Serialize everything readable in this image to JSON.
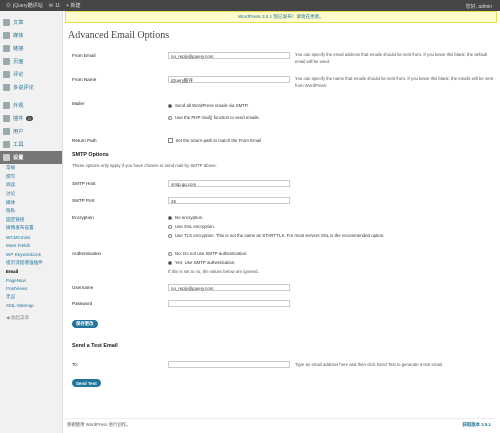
{
  "topbar": {
    "site": "jQuery酷评站",
    "comments": "11",
    "new": "+ 新建",
    "user": "您好, admin"
  },
  "notice": "WordPress 3.5.1 现已发布！请现在更新。",
  "sidebar": {
    "items": [
      "文章",
      "媒体",
      "链接",
      "页面",
      "评论",
      "多说评论"
    ],
    "items2": [
      "外观",
      "插件",
      "用户",
      "工具"
    ],
    "plugin_badge": "0",
    "settings": "设置",
    "subs": [
      "常规",
      "撰写",
      "阅读",
      "讨论",
      "媒体",
      "隐私",
      "固定链接",
      "微博发布设置",
      "WCMCmiss",
      "More Fields",
      "WP KeywordLink",
      "提示流程增强插件"
    ],
    "current": "Email",
    "subs2": [
      "PageNavi",
      "PostViews",
      "无忌",
      "XML-Sitemap"
    ],
    "collapse": "收起菜单"
  },
  "page": {
    "title": "Advanced Email Options",
    "from_email": {
      "label": "From Email",
      "value": "no_reply@jquery.com",
      "desc": "You can specify the email address that emails should be sent from. If you leave this blank, the default email will be used."
    },
    "from_name": {
      "label": "From Name",
      "value": "jQuery酷评",
      "desc": "You can specify the name that emails should be sent from. If you leave this blank, the emails will be sent from WordPress."
    },
    "mailer": {
      "label": "Mailer",
      "opt1": "Send all WordPress emails via SMTP.",
      "opt2": "Use the PHP mail() function to send emails."
    },
    "return_path": {
      "label": "Return Path",
      "opt": "Set the return-path to match the From Email"
    },
    "smtp": {
      "heading": "SMTP Options",
      "intro": "These options only apply if you have chosen to send mail by SMTP above.",
      "host_label": "SMTP Host",
      "host_value": "smtp.qq.com",
      "port_label": "SMTP Port",
      "port_value": "25",
      "enc_label": "Encryption",
      "enc1": "No encryption.",
      "enc2": "Use SSL encryption.",
      "enc3": "Use TLS encryption. This is not the same as STARTTLS. For most servers SSL is the recommended option.",
      "auth_label": "Authentication",
      "auth1": "No: Do not use SMTP authentication.",
      "auth2": "Yes: Use SMTP authentication.",
      "auth_note": "If this is set to no, the values below are ignored.",
      "user_label": "Username",
      "user_value": "no_reply@jquery.com",
      "pass_label": "Password",
      "save": "保存更改"
    },
    "test": {
      "heading": "Send a Test Email",
      "to_label": "To:",
      "to_desc": "Type an email address here and then click Send Test to generate a test email.",
      "button": "Send Test"
    }
  },
  "footer": {
    "left": "感谢使用 WordPress 进行创作。",
    "right": "获取版本 3.5.1"
  }
}
